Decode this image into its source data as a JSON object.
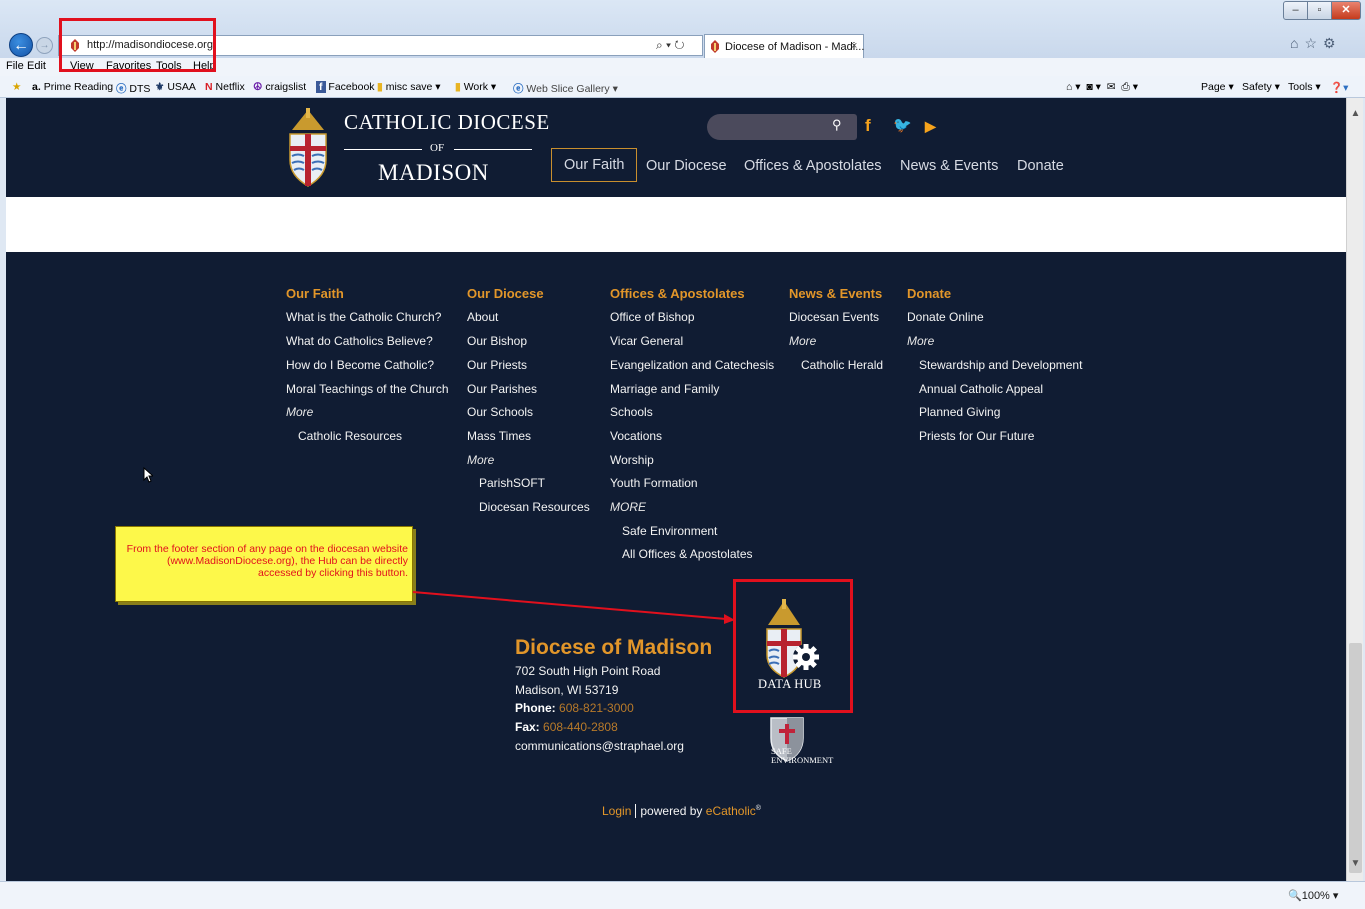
{
  "browser": {
    "url": "http://madisondiocese.org/",
    "tab_title": "Diocese of Madison - Madi...",
    "tab_close": "×",
    "search_glyph": "⌕ ▾ ↻",
    "menu": [
      "File",
      "Edit",
      "View",
      "Favorites",
      "Tools",
      "Help"
    ],
    "favorites": [
      {
        "icon": "a.",
        "label": "Prime Reading"
      },
      {
        "icon": "ⓔ",
        "label": "DTS"
      },
      {
        "icon": "⚜",
        "label": "USAA"
      },
      {
        "icon": "N",
        "label": "Netflix"
      },
      {
        "icon": "☮",
        "label": "craigslist"
      },
      {
        "icon": "f",
        "label": "Facebook"
      },
      {
        "icon": "▮",
        "label": "misc save ▾"
      },
      {
        "icon": "▮",
        "label": "Work ▾"
      },
      {
        "icon": "ⓔ",
        "label": "Web Slice Gallery ▾"
      }
    ],
    "command_bar": [
      "Page ▾",
      "Safety ▾",
      "Tools ▾"
    ],
    "zoom": "100%"
  },
  "header": {
    "logo_line1": "CATHOLIC DIOCESE",
    "logo_line2": "OF",
    "logo_line3": "MADISON",
    "nav": [
      "Our Faith",
      "Our Diocese",
      "Offices & Apostolates",
      "News & Events",
      "Donate"
    ]
  },
  "footer": {
    "columns": [
      {
        "heading": "Our Faith",
        "links": [
          "What is the Catholic Church?",
          "What do Catholics Believe?",
          "How do I Become Catholic?",
          "Moral Teachings of the Church"
        ],
        "more": "More",
        "sub": [
          "Catholic Resources"
        ]
      },
      {
        "heading": "Our Diocese",
        "links": [
          "About",
          "Our Bishop",
          "Our Priests",
          "Our Parishes",
          "Our Schools",
          "Mass Times"
        ],
        "more": "More",
        "sub": [
          "ParishSOFT",
          "Diocesan Resources"
        ]
      },
      {
        "heading": "Offices & Apostolates",
        "links": [
          "Office of Bishop",
          "Vicar General",
          "Evangelization and Catechesis",
          "Marriage and Family",
          "Schools",
          "Vocations",
          "Worship",
          "Youth Formation"
        ],
        "more": "MORE",
        "sub": [
          "Safe Environment",
          "All Offices & Apostolates"
        ]
      },
      {
        "heading": "News & Events",
        "links": [
          "Diocesan Events"
        ],
        "more": "More",
        "sub": [
          "Catholic Herald"
        ]
      },
      {
        "heading": "Donate",
        "links": [
          "Donate Online"
        ],
        "more": "More",
        "sub": [
          "Stewardship and Development",
          "Annual Catholic Appeal",
          "Planned Giving",
          "Priests for Our Future"
        ]
      }
    ],
    "org_name": "Diocese of Madison",
    "address1": "702 South High Point Road",
    "address2": "Madison, WI 53719",
    "phone_label": "Phone:",
    "phone": "608-821-3000",
    "fax_label": "Fax:",
    "fax": "608-440-2808",
    "email": "communications@straphael.org",
    "hub_label": "DATA HUB",
    "se_label1": "SAFE",
    "se_label2": "ENVIRONMENT",
    "login": "Login",
    "powered_by": "powered by",
    "ecatholic": "eCatholic",
    "reg": "®"
  },
  "annotation": {
    "callout_text": "From the footer section of any page on the diocesan website (www.MadisonDiocese.org), the Hub can be directly accessed by clicking this button."
  },
  "colors": {
    "navy": "#101c33",
    "gold": "#e2962a",
    "annotation_red": "#e1101d",
    "callout_yellow": "#fdf84a"
  }
}
